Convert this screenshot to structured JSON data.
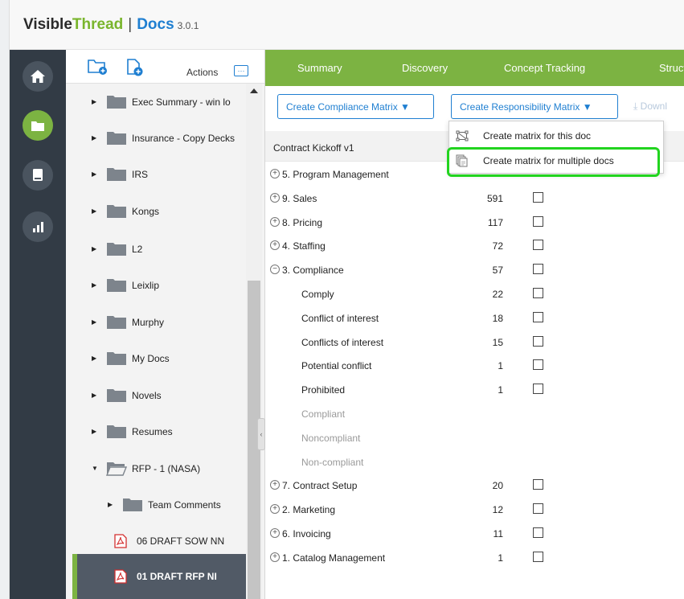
{
  "header": {
    "brand_main": "Visible",
    "brand_accent": "Thread",
    "separator": "|",
    "product": "Docs",
    "version": "3.0.1"
  },
  "rail": {
    "items": [
      {
        "icon": "home-icon",
        "active": false
      },
      {
        "icon": "folder-icon",
        "active": true
      },
      {
        "icon": "book-icon",
        "active": false
      },
      {
        "icon": "bar-chart-icon",
        "active": false
      }
    ]
  },
  "tree": {
    "toolbar": {
      "new_folder_icon": "new-folder-icon",
      "new_document_icon": "new-document-icon",
      "actions_label": "Actions",
      "actions_icon": "ellipsis-icon"
    },
    "folders": [
      {
        "label": "Exec Summary - win lo"
      },
      {
        "label": "Insurance - Copy Decks"
      },
      {
        "label": "IRS"
      },
      {
        "label": "Kongs"
      },
      {
        "label": "L2"
      },
      {
        "label": "Leixlip"
      },
      {
        "label": "Murphy"
      },
      {
        "label": "My Docs"
      },
      {
        "label": "Novels"
      },
      {
        "label": "Resumes"
      },
      {
        "label": "RFP - 1 (NASA)"
      }
    ],
    "subfolder": {
      "label": "Team Comments"
    },
    "files": [
      {
        "label": "06 DRAFT SOW NN"
      },
      {
        "label": "01 DRAFT RFP NI"
      }
    ]
  },
  "nav": {
    "tabs": [
      "Summary",
      "Discovery",
      "Concept Tracking",
      "Structu"
    ]
  },
  "toolbar": {
    "compliance_button": "Create Compliance Matrix ▼",
    "responsibility_button": "Create Responsibility Matrix ▼",
    "download_label": "Downl"
  },
  "menu": {
    "items": [
      {
        "label": "Create matrix for this doc",
        "icon": "matrix-icon"
      },
      {
        "label": "Create matrix for multiple docs",
        "icon": "multiple-docs-icon"
      }
    ]
  },
  "document": {
    "title": "Contract Kickoff v1"
  },
  "concepts": [
    {
      "toggle": "+",
      "name": "5. Program Management",
      "count": "",
      "checkbox": false,
      "level": 0,
      "muted": false
    },
    {
      "toggle": "+",
      "name": "9. Sales",
      "count": "591",
      "checkbox": true,
      "level": 0,
      "muted": false
    },
    {
      "toggle": "+",
      "name": "8. Pricing",
      "count": "117",
      "checkbox": true,
      "level": 0,
      "muted": false
    },
    {
      "toggle": "+",
      "name": "4. Staffing",
      "count": "72",
      "checkbox": true,
      "level": 0,
      "muted": false
    },
    {
      "toggle": "−",
      "name": "3. Compliance",
      "count": "57",
      "checkbox": true,
      "level": 0,
      "muted": false
    },
    {
      "toggle": "",
      "name": "Comply",
      "count": "22",
      "checkbox": true,
      "level": 1,
      "muted": false
    },
    {
      "toggle": "",
      "name": "Conflict of interest",
      "count": "18",
      "checkbox": true,
      "level": 1,
      "muted": false
    },
    {
      "toggle": "",
      "name": "Conflicts of interest",
      "count": "15",
      "checkbox": true,
      "level": 1,
      "muted": false
    },
    {
      "toggle": "",
      "name": "Potential conflict",
      "count": "1",
      "checkbox": true,
      "level": 1,
      "muted": false
    },
    {
      "toggle": "",
      "name": "Prohibited",
      "count": "1",
      "checkbox": true,
      "level": 1,
      "muted": false
    },
    {
      "toggle": "",
      "name": "Compliant",
      "count": "",
      "checkbox": false,
      "level": 1,
      "muted": true
    },
    {
      "toggle": "",
      "name": "Noncompliant",
      "count": "",
      "checkbox": false,
      "level": 1,
      "muted": true
    },
    {
      "toggle": "",
      "name": "Non-compliant",
      "count": "",
      "checkbox": false,
      "level": 1,
      "muted": true
    },
    {
      "toggle": "+",
      "name": "7. Contract Setup",
      "count": "20",
      "checkbox": true,
      "level": 0,
      "muted": false
    },
    {
      "toggle": "+",
      "name": "2. Marketing",
      "count": "12",
      "checkbox": true,
      "level": 0,
      "muted": false
    },
    {
      "toggle": "+",
      "name": "6. Invoicing",
      "count": "11",
      "checkbox": true,
      "level": 0,
      "muted": false
    },
    {
      "toggle": "+",
      "name": "1. Catalog Management",
      "count": "1",
      "checkbox": true,
      "level": 0,
      "muted": false
    }
  ],
  "colors": {
    "brand_green": "#7cb342",
    "brand_blue": "#1f7fd1",
    "rail_bg": "#323b45",
    "highlight": "#22d41f"
  }
}
